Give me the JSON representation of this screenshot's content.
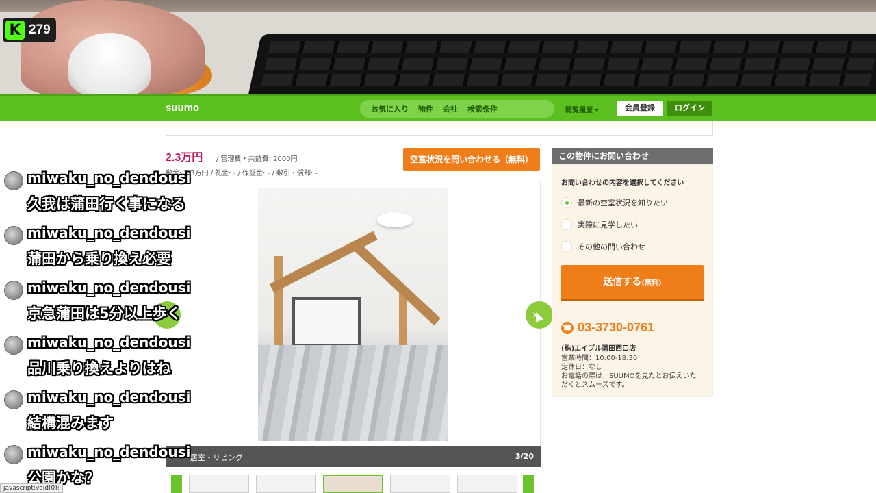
{
  "stream": {
    "viewer_count": "279",
    "logo_letter": "K"
  },
  "header": {
    "logo": "suumo",
    "nav": [
      "お気に入り",
      "物件",
      "会社",
      "検索条件"
    ],
    "history": "閲覧履歴 ▾",
    "register": "会員登録",
    "login": "ログイン"
  },
  "listing": {
    "price": "2.3万円",
    "management_fee": "/ 管理費・共益費: 2000円",
    "fees": "敷金: 2.3万円 / 礼金: - / 保証金: - / 敷引・償却: -",
    "inquire_button": "空室状況を問い合わせる（無料）"
  },
  "gallery": {
    "caption": "居室・リビング",
    "counter": "3/20",
    "next_arrow": "›"
  },
  "inquiry": {
    "title": "この物件にお問い合わせ",
    "question": "お問い合わせの内容を選択してください",
    "options": [
      "最新の空室状況を知りたい",
      "実際に見学したい",
      "その他の問い合わせ"
    ],
    "selected_index": 0,
    "send_label": "送信する",
    "send_note": "(無料)",
    "phone": "03-3730-0761",
    "store": "(株)エイブル蒲田西口店",
    "hours": "営業時間：10:00-18:30",
    "holiday": "定休日：なし",
    "note1": "お電話の際は、SUUMOを見たとお伝えいた",
    "note2": "だくとスムーズです。"
  },
  "chat": {
    "messages": [
      {
        "user": "miwaku_no_dendousi",
        "text": "久我は蒲田行く事になる"
      },
      {
        "user": "miwaku_no_dendousi",
        "text": "蒲田から乗り換え必要"
      },
      {
        "user": "miwaku_no_dendousi",
        "text": "京急蒲田は5分以上歩く"
      },
      {
        "user": "miwaku_no_dendousi",
        "text": "品川乗り換えよりはね"
      },
      {
        "user": "miwaku_no_dendousi",
        "text": "結構混みます"
      },
      {
        "user": "miwaku_no_dendousi",
        "text": "公園かな？"
      }
    ]
  },
  "statusbar": "javascript:void(0);",
  "colors": {
    "suumo_green": "#5bbf1f",
    "accent_orange": "#ef7d1a",
    "price_pink": "#c2185b"
  }
}
